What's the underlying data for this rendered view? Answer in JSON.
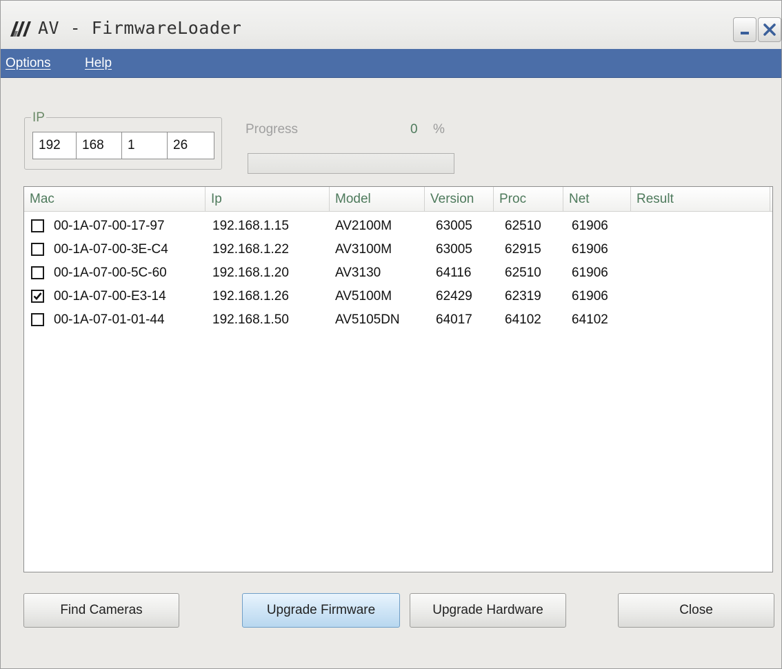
{
  "window": {
    "title": "AV - FirmwareLoader"
  },
  "menu": {
    "options": "Options",
    "help": "Help"
  },
  "ip": {
    "label": "IP",
    "octets": [
      "192",
      "168",
      "1",
      "26"
    ]
  },
  "progress": {
    "label": "Progress",
    "value": "0",
    "unit": "%",
    "fraction": 0
  },
  "list": {
    "columns": [
      "Mac",
      "Ip",
      "Model",
      "Version",
      "Proc",
      "Net",
      "Result"
    ],
    "rows": [
      {
        "checked": false,
        "mac": "00-1A-07-00-17-97",
        "ip": "192.168.1.15",
        "model": "AV2100M",
        "version": "63005",
        "proc": "62510",
        "net": "61906",
        "result": ""
      },
      {
        "checked": false,
        "mac": "00-1A-07-00-3E-C4",
        "ip": "192.168.1.22",
        "model": "AV3100M",
        "version": "63005",
        "proc": "62915",
        "net": "61906",
        "result": ""
      },
      {
        "checked": false,
        "mac": "00-1A-07-00-5C-60",
        "ip": "192.168.1.20",
        "model": "AV3130",
        "version": "64116",
        "proc": "62510",
        "net": "61906",
        "result": ""
      },
      {
        "checked": true,
        "mac": "00-1A-07-00-E3-14",
        "ip": "192.168.1.26",
        "model": "AV5100M",
        "version": "62429",
        "proc": "62319",
        "net": "61906",
        "result": ""
      },
      {
        "checked": false,
        "mac": "00-1A-07-01-01-44",
        "ip": "192.168.1.50",
        "model": "AV5105DN",
        "version": "64017",
        "proc": "64102",
        "net": "64102",
        "result": ""
      }
    ]
  },
  "buttons": {
    "find": "Find Cameras",
    "upgrade_firmware": "Upgrade Firmware",
    "upgrade_hardware": "Upgrade Hardware",
    "close": "Close"
  },
  "colors": {
    "menubar": "#4b6ea8",
    "column_header_text": "#4e7a5c",
    "focused_button": "#cfe5f6"
  },
  "icons": {
    "app_logo": "av-logo-icon",
    "minimize": "minimize-icon",
    "close": "close-icon",
    "checkbox": "checkbox-icon"
  }
}
